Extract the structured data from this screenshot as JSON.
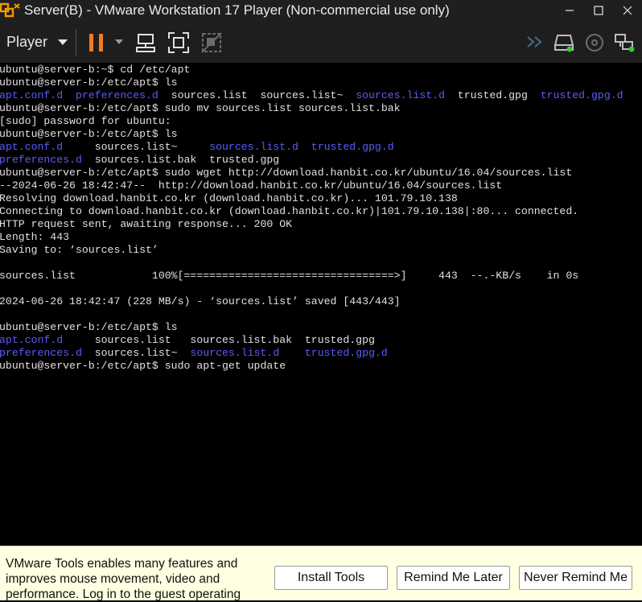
{
  "window": {
    "title": "Server(B) - VMware Workstation 17 Player (Non-commercial use only)",
    "app_icon": "vmware-icon"
  },
  "toolbar": {
    "player_menu_label": "Player",
    "icons": [
      "pause-icon",
      "dropdown-arrow-icon",
      "send-ctrl-alt-del-icon",
      "full-screen-icon",
      "unity-icon",
      "network-activity-icon",
      "hard-disk-icon",
      "cd-dvd-icon",
      "network-adapter-icon"
    ]
  },
  "terminal": {
    "lines": [
      [
        {
          "t": "ubuntu@server-b:~$ cd /etc/apt"
        }
      ],
      [
        {
          "t": "ubuntu@server-b:/etc/apt$ ls"
        }
      ],
      [
        {
          "t": "apt.conf.d",
          "c": "blue"
        },
        {
          "t": "  "
        },
        {
          "t": "preferences.d",
          "c": "blue"
        },
        {
          "t": "  sources.list  sources.list~  "
        },
        {
          "t": "sources.list.d",
          "c": "blue"
        },
        {
          "t": "  trusted.gpg  "
        },
        {
          "t": "trusted.gpg.d",
          "c": "blue"
        }
      ],
      [
        {
          "t": "ubuntu@server-b:/etc/apt$ sudo mv sources.list sources.list.bak"
        }
      ],
      [
        {
          "t": "[sudo] password for ubuntu:"
        }
      ],
      [
        {
          "t": "ubuntu@server-b:/etc/apt$ ls"
        }
      ],
      [
        {
          "t": "apt.conf.d",
          "c": "blue"
        },
        {
          "t": "     sources.list~     "
        },
        {
          "t": "sources.list.d",
          "c": "blue"
        },
        {
          "t": "  "
        },
        {
          "t": "trusted.gpg.d",
          "c": "blue"
        }
      ],
      [
        {
          "t": "preferences.d",
          "c": "blue"
        },
        {
          "t": "  sources.list.bak  trusted.gpg"
        }
      ],
      [
        {
          "t": "ubuntu@server-b:/etc/apt$ sudo wget http://download.hanbit.co.kr/ubuntu/16.04/sources.list"
        }
      ],
      [
        {
          "t": "--2024-06-26 18:42:47--  http://download.hanbit.co.kr/ubuntu/16.04/sources.list"
        }
      ],
      [
        {
          "t": "Resolving download.hanbit.co.kr (download.hanbit.co.kr)... 101.79.10.138"
        }
      ],
      [
        {
          "t": "Connecting to download.hanbit.co.kr (download.hanbit.co.kr)|101.79.10.138|:80... connected."
        }
      ],
      [
        {
          "t": "HTTP request sent, awaiting response... 200 OK"
        }
      ],
      [
        {
          "t": "Length: 443"
        }
      ],
      [
        {
          "t": "Saving to: ‘sources.list’"
        }
      ],
      [
        {
          "t": ""
        }
      ],
      [
        {
          "t": "sources.list            100%[=================================>]     443  --.-KB/s    in 0s"
        }
      ],
      [
        {
          "t": ""
        }
      ],
      [
        {
          "t": "2024-06-26 18:42:47 (228 MB/s) - ‘sources.list’ saved [443/443]"
        }
      ],
      [
        {
          "t": ""
        }
      ],
      [
        {
          "t": "ubuntu@server-b:/etc/apt$ ls"
        }
      ],
      [
        {
          "t": "apt.conf.d",
          "c": "blue"
        },
        {
          "t": "     sources.list   sources.list.bak  trusted.gpg"
        }
      ],
      [
        {
          "t": "preferences.d",
          "c": "blue"
        },
        {
          "t": "  sources.list~  "
        },
        {
          "t": "sources.list.d",
          "c": "blue"
        },
        {
          "t": "    "
        },
        {
          "t": "trusted.gpg.d",
          "c": "blue"
        }
      ],
      [
        {
          "t": "ubuntu@server-b:/etc/apt$ sudo apt-get update"
        }
      ]
    ]
  },
  "notification": {
    "text": "VMware Tools enables many features and improves mouse movement, video and performance. Log in to the guest operating",
    "install_label": "Install Tools",
    "remind_label": "Remind Me Later",
    "never_label": "Never Remind Me"
  }
}
